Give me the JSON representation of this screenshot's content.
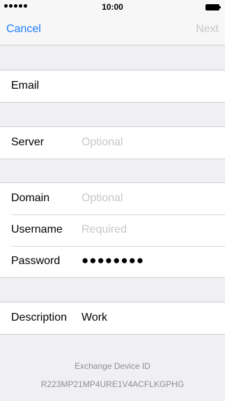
{
  "status_bar": {
    "time": "10:00"
  },
  "nav": {
    "cancel": "Cancel",
    "next": "Next"
  },
  "fields": {
    "email": {
      "label": "Email",
      "value": ""
    },
    "server": {
      "label": "Server",
      "placeholder": "Optional"
    },
    "domain": {
      "label": "Domain",
      "placeholder": "Optional"
    },
    "username": {
      "label": "Username",
      "placeholder": "Required"
    },
    "password": {
      "label": "Password",
      "value": "●●●●●●●●"
    },
    "description": {
      "label": "Description",
      "value": "Work"
    }
  },
  "footer": {
    "title": "Exchange Device ID",
    "device_id": "R223MP21MP4URE1V4ACFLKGPHG"
  },
  "colors": {
    "accent": "#1a7dfa",
    "placeholder": "#c7c7cc",
    "background": "#efeff4"
  }
}
